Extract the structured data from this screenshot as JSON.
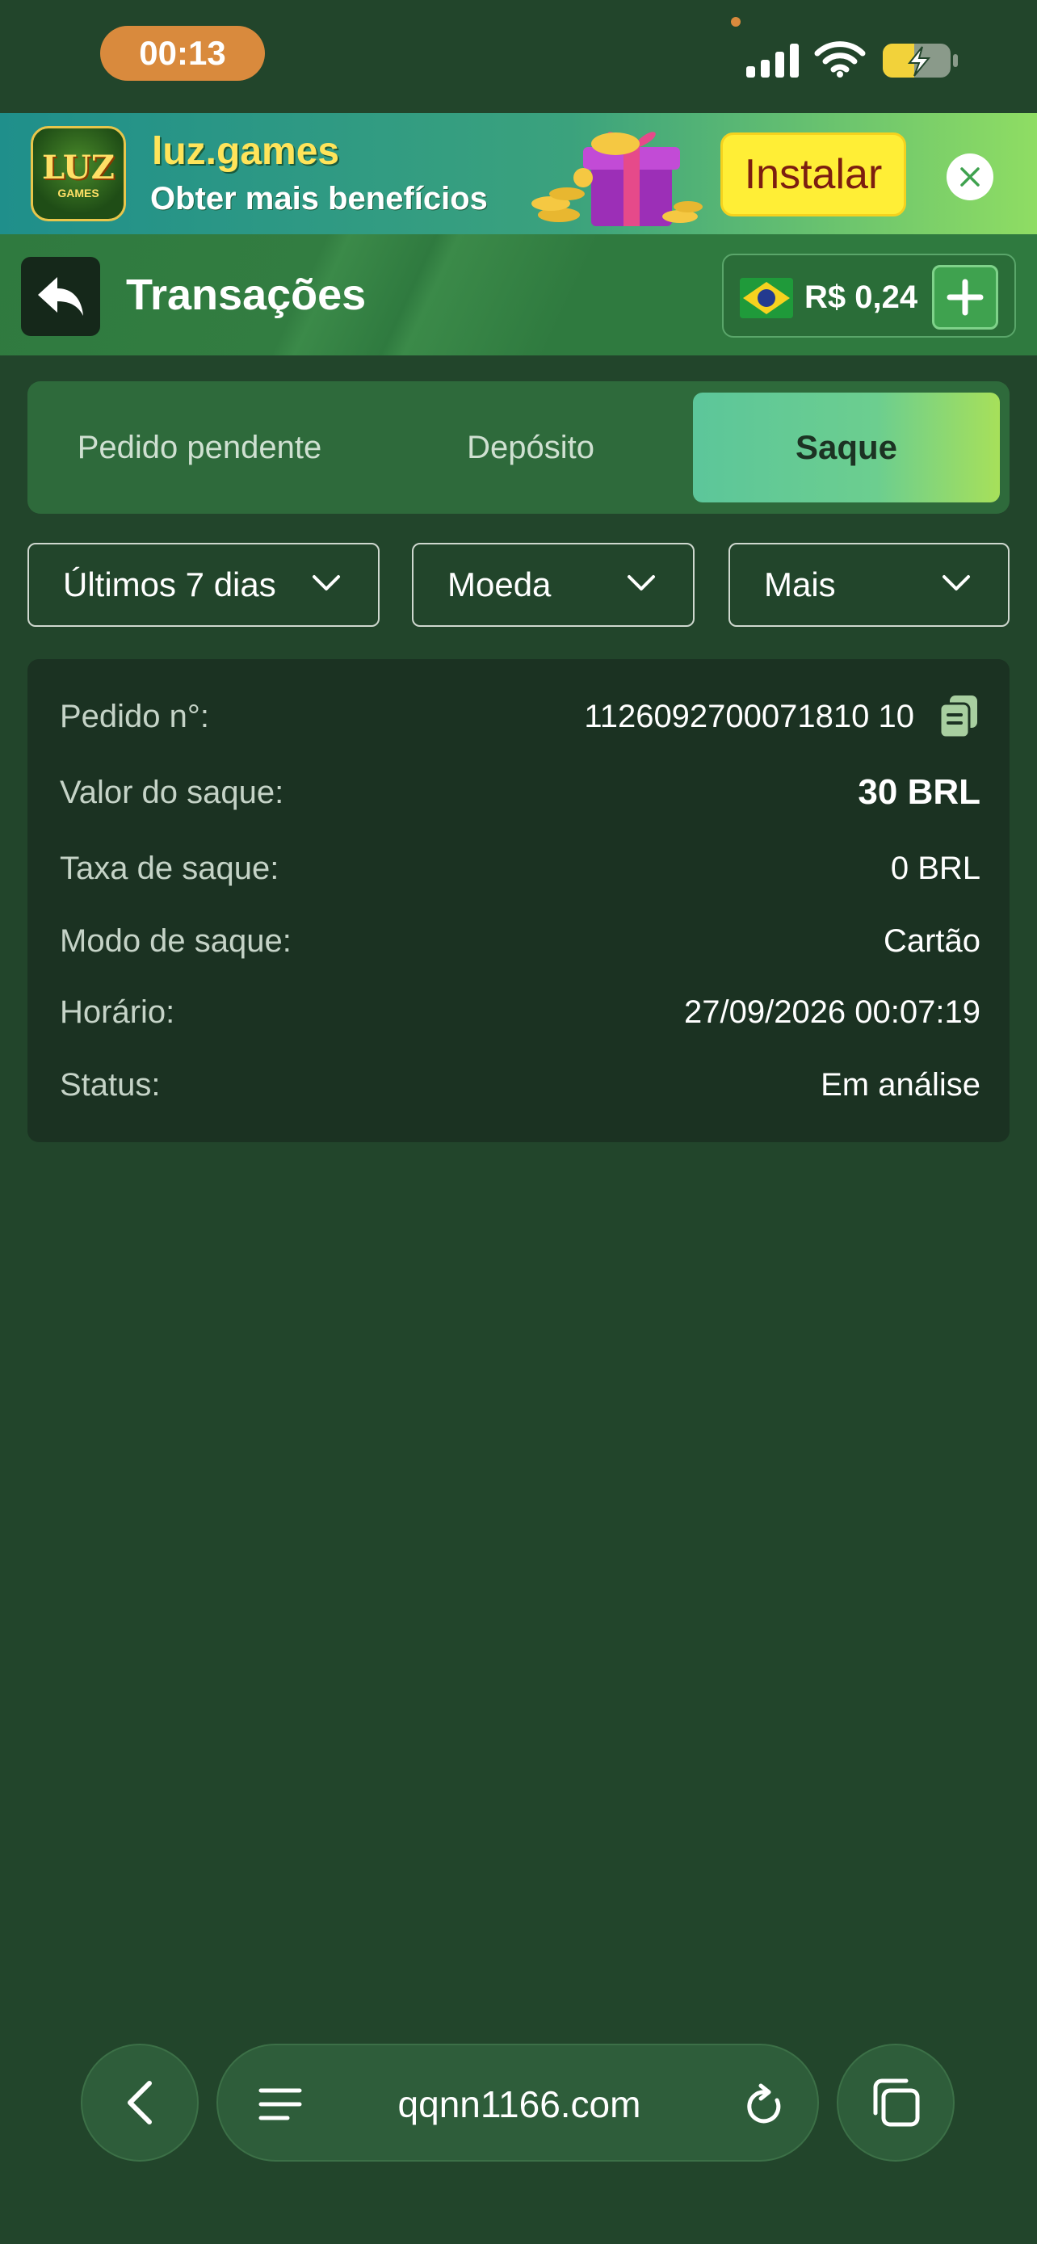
{
  "status_bar": {
    "time": "00:13"
  },
  "banner": {
    "logo_text": "LUZ",
    "logo_subtext": "GAMES",
    "title": "luz.games",
    "subtitle": "Obter mais benefícios",
    "install_label": "Instalar"
  },
  "header": {
    "title": "Transações",
    "balance": "R$ 0,24"
  },
  "tabs": [
    {
      "label": "Pedido pendente",
      "active": false
    },
    {
      "label": "Depósito",
      "active": false
    },
    {
      "label": "Saque",
      "active": true
    }
  ],
  "filters": {
    "period": "Últimos 7 dias",
    "currency": "Moeda",
    "more": "Mais"
  },
  "record": {
    "order_label": "Pedido n°:",
    "order_value": "1126092700071810 10",
    "amount_label": "Valor do saque:",
    "amount_value": "30 BRL",
    "fee_label": "Taxa de saque:",
    "fee_value": "0 BRL",
    "mode_label": "Modo de saque:",
    "mode_value": "Cartão",
    "time_label": "Horário:",
    "time_value": "27/09/2026 00:07:19",
    "status_label": "Status:",
    "status_value": "Em análise"
  },
  "browser": {
    "url": "qqnn1166.com"
  },
  "colors": {
    "background": "#22452b",
    "accent_green": "#3fa24f",
    "active_tab_start": "#5cc69a",
    "active_tab_end": "#a7e05a",
    "install_yellow": "#ffee36",
    "time_pill": "#d98a3d"
  }
}
